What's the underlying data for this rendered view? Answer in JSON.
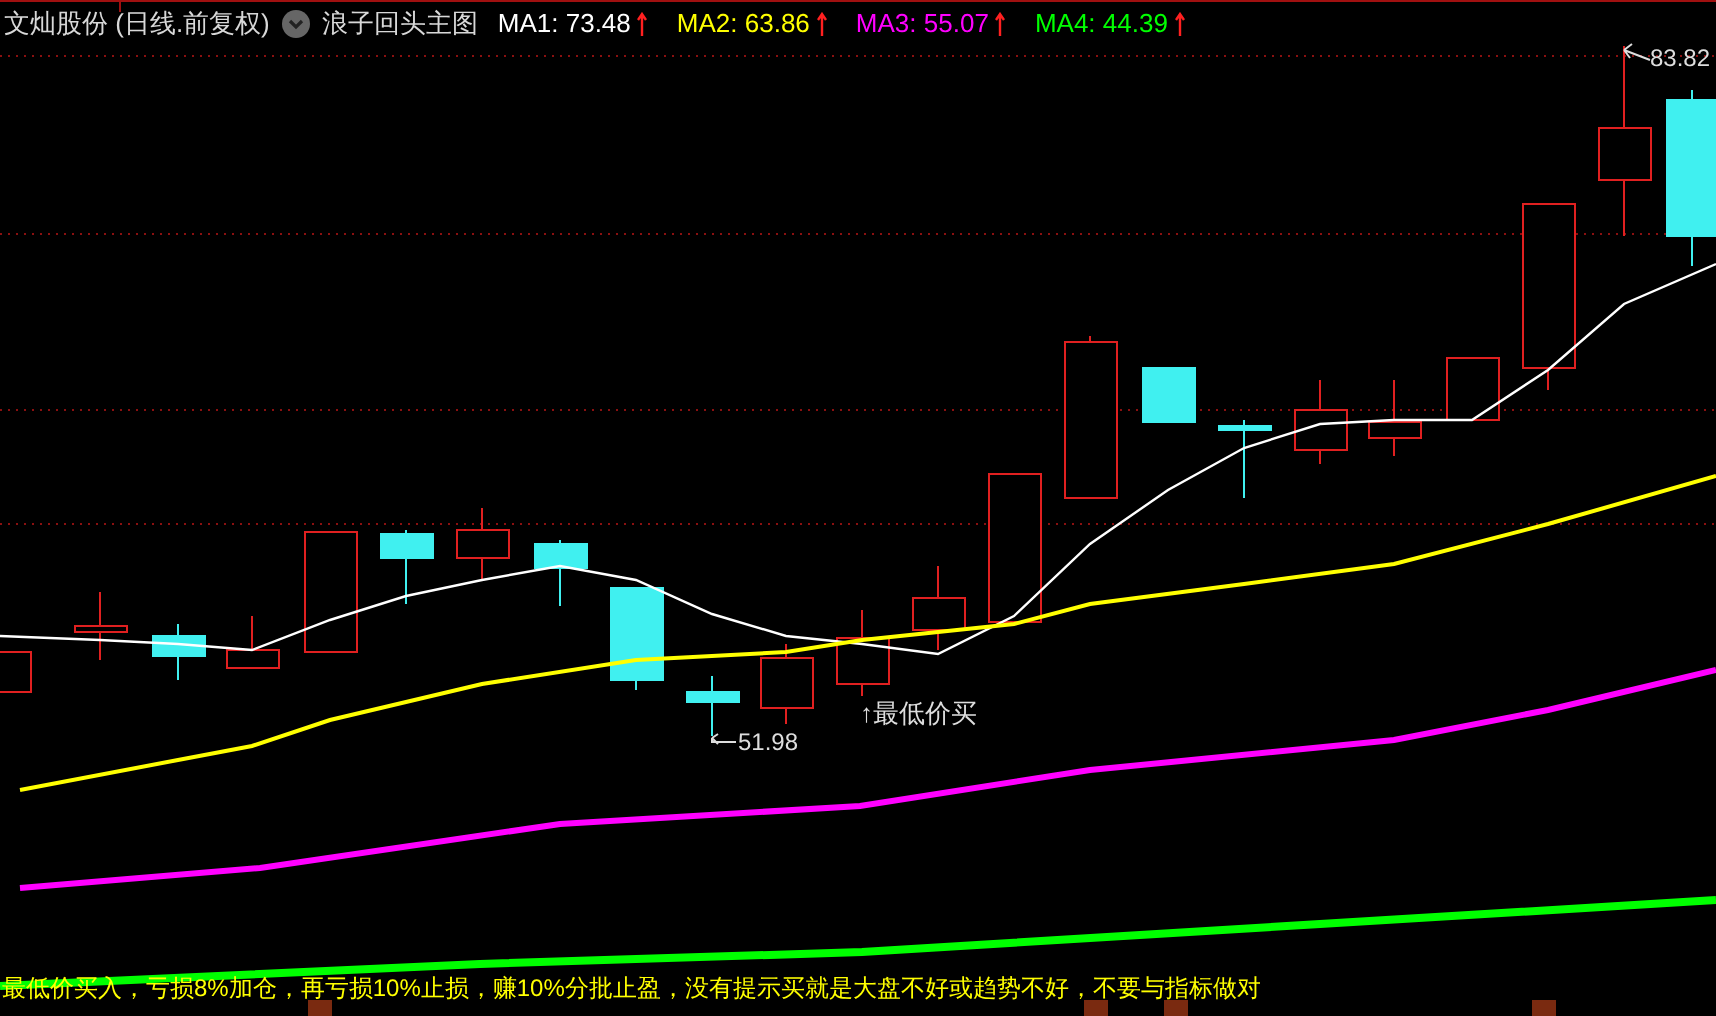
{
  "header": {
    "stock": "文灿股份 (日线.前复权)",
    "indicator_name": "浪子回头主图"
  },
  "moving_averages": [
    {
      "label": "MA1:",
      "value": "73.48",
      "color": "#ffffff"
    },
    {
      "label": "MA2:",
      "value": "63.86",
      "color": "#ffff00"
    },
    {
      "label": "MA3:",
      "value": "55.07",
      "color": "#ff00ff"
    },
    {
      "label": "MA4:",
      "value": "44.39",
      "color": "#00ff00"
    }
  ],
  "chart": {
    "high_label": "83.82",
    "low_label": "51.98",
    "signal_label": "↑最低价买"
  },
  "strategy_note": "最低价买入，亏损8%加仓，再亏损10%止损，赚10%分批止盈，没有提示买就是大盘不好或趋势不好，不要与指标做对"
}
